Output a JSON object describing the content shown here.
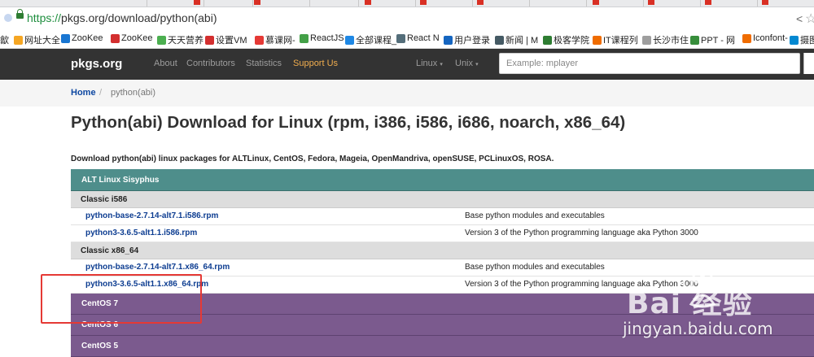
{
  "browser": {
    "url_scheme": "https://",
    "url_rest": "pkgs.org/download/python(abi)",
    "bookmarks": [
      {
        "label": "歙",
        "color": "#ffffff"
      },
      {
        "label": "网址大全",
        "color": "#f5a623"
      },
      {
        "label": "ZooKee",
        "color": "#1976d2"
      },
      {
        "label": "ZooKee",
        "color": "#d32f2f"
      },
      {
        "label": "天天营养",
        "color": "#4caf50"
      },
      {
        "label": "设置VM",
        "color": "#d32f2f"
      },
      {
        "label": "慕课网-",
        "color": "#e53935"
      },
      {
        "label": "ReactJS",
        "color": "#43a047"
      },
      {
        "label": "全部课程_",
        "color": "#1e88e5"
      },
      {
        "label": "React N",
        "color": "#546e7a"
      },
      {
        "label": "用户登录",
        "color": "#1565c0"
      },
      {
        "label": "新闻 | M",
        "color": "#455a64"
      },
      {
        "label": "极客学院",
        "color": "#2e7d32"
      },
      {
        "label": "IT课程列",
        "color": "#ef6c00"
      },
      {
        "label": "长沙市住",
        "color": "#9e9e9e"
      },
      {
        "label": "PPT - 网",
        "color": "#388e3c"
      },
      {
        "label": "Iconfont-",
        "color": "#ef6c00"
      },
      {
        "label": "摄图",
        "color": "#0288d1"
      }
    ]
  },
  "nav": {
    "brand": "pkgs.org",
    "links": [
      "About",
      "Contributors",
      "Statistics",
      "Support Us"
    ],
    "dropdowns": [
      "Linux",
      "Unix"
    ],
    "search_placeholder": "Example: mplayer"
  },
  "breadcrumb": {
    "home": "Home",
    "sep": "/",
    "current": "python(abi)"
  },
  "page": {
    "title": "Python(abi) Download for Linux (rpm, i386, i586, i686, noarch, x86_64)",
    "description": "Download python(abi) linux packages for ALTLinux, CentOS, Fedora, Mageia, OpenMandriva, openSUSE, PCLinuxOS, ROSA."
  },
  "alt_linux": {
    "name": "ALT Linux Sisyphus",
    "groups": [
      {
        "name": "Classic i586",
        "rows": [
          {
            "pkg": "python-base-2.7.14-alt7.1.i586.rpm",
            "summary": "Base python modules and executables"
          },
          {
            "pkg": "python3-3.6.5-alt1.1.i586.rpm",
            "summary": "Version 3 of the Python programming language aka Python 3000"
          }
        ]
      },
      {
        "name": "Classic x86_64",
        "rows": [
          {
            "pkg": "python-base-2.7.14-alt7.1.x86_64.rpm",
            "summary": "Base python modules and executables"
          },
          {
            "pkg": "python3-3.6.5-alt1.1.x86_64.rpm",
            "summary": "Version 3 of the Python programming language aka Python 3000"
          }
        ]
      }
    ]
  },
  "distros": [
    "CentOS 7",
    "CentOS 6",
    "CentOS 5"
  ],
  "watermark": {
    "logo": "Bai  经验",
    "url": "jingyan.baidu.com"
  }
}
